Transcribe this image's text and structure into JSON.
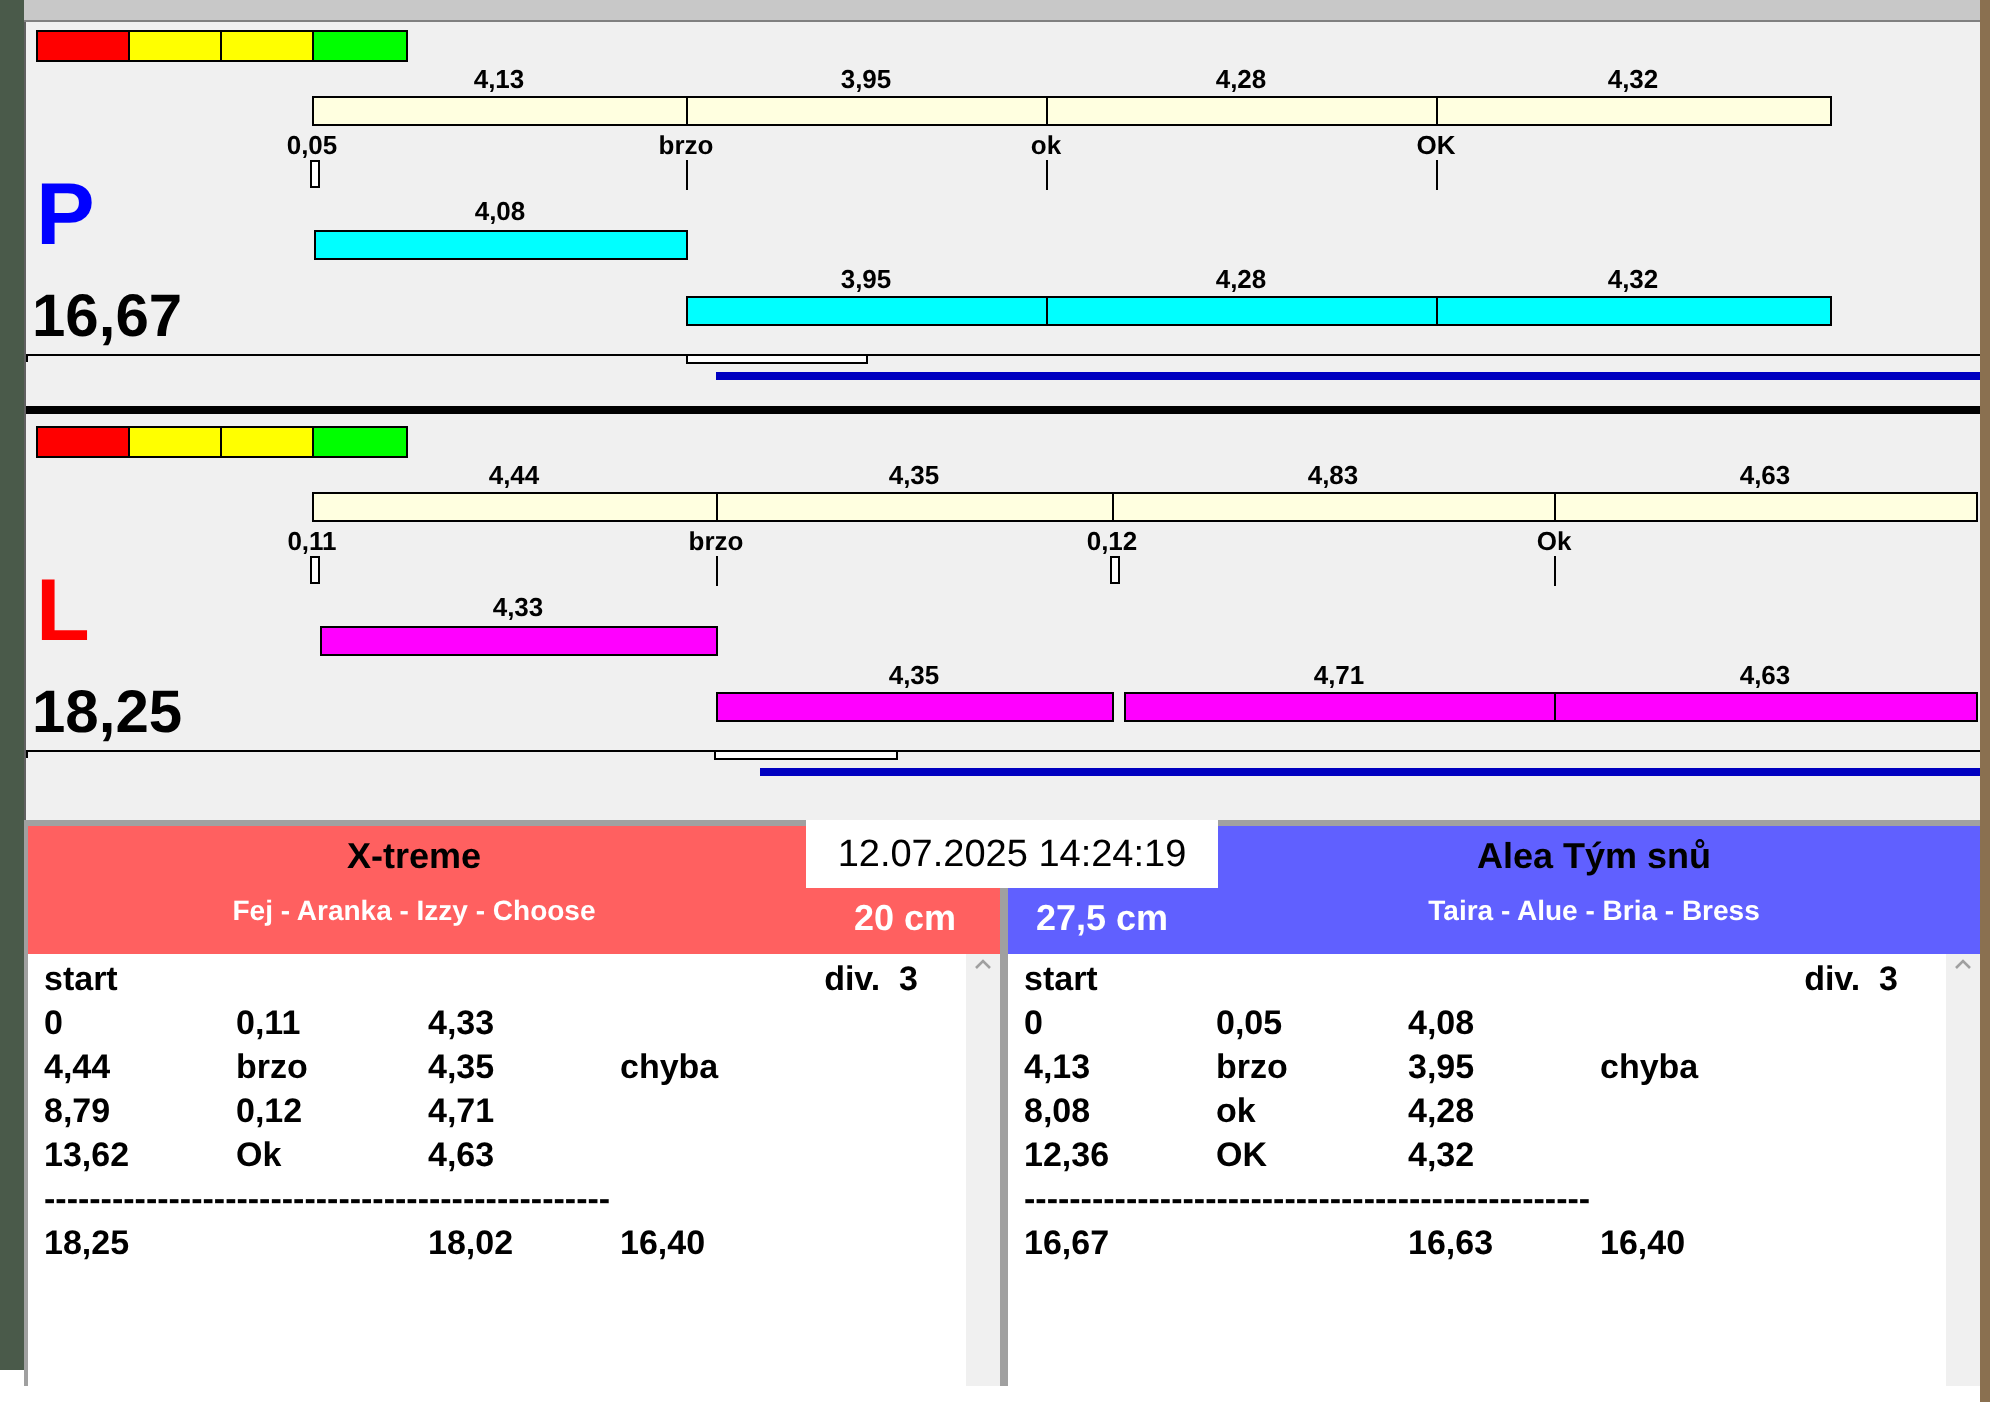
{
  "lanes": [
    {
      "letter": "P",
      "color": "#0000ff",
      "score": "16,67",
      "indicator": [
        {
          "color": "#ff0000"
        },
        {
          "color": "#ffff00"
        },
        {
          "color": "#ffff00"
        },
        {
          "color": "#00ff00"
        }
      ],
      "reference": [
        {
          "time": "4,13",
          "mark": "0,05",
          "kind": "box"
        },
        {
          "time": "3,95",
          "mark": "brzo",
          "kind": "line"
        },
        {
          "time": "4,28",
          "mark": "ok",
          "kind": "line"
        },
        {
          "time": "4,32",
          "mark": "OK",
          "kind": "line"
        }
      ],
      "runs": [
        "4,08",
        "3,95",
        "4,28",
        "4,32"
      ]
    },
    {
      "letter": "L",
      "color": "#ff0000",
      "score": "18,25",
      "indicator": [
        {
          "color": "#ff0000"
        },
        {
          "color": "#ffff00"
        },
        {
          "color": "#ffff00"
        },
        {
          "color": "#00ff00"
        }
      ],
      "reference": [
        {
          "time": "4,44",
          "mark": "0,11",
          "kind": "box"
        },
        {
          "time": "4,35",
          "mark": "brzo",
          "kind": "line"
        },
        {
          "time": "4,83",
          "mark": "0,12",
          "kind": "box"
        },
        {
          "time": "4,63",
          "mark": "Ok",
          "kind": "line"
        }
      ],
      "runs": [
        "4,33",
        "4,35",
        "4,71",
        "4,63"
      ]
    }
  ],
  "timestamp": "12.07.2025 14:24:19",
  "teams": [
    {
      "name": "X-treme",
      "members": "Fej - Aranka - Izzy - Choose",
      "height": "20 cm",
      "color": "#ff6060",
      "start": "start",
      "division": "div.  3",
      "rows": [
        [
          "0",
          "0,11",
          "4,33"
        ],
        [
          "4,44",
          "brzo",
          "4,35",
          "chyba"
        ],
        [
          "8,79",
          "0,12",
          "4,71"
        ],
        [
          "13,62",
          "Ok",
          "4,63"
        ]
      ],
      "separator": "--------------------------------------------------",
      "total": {
        "column_1": "18,25",
        "column_3": "18,02",
        "column_4": "16,40"
      }
    },
    {
      "name": "Alea Tým snů",
      "members": "Taira - Alue - Bria - Bress",
      "height": "27,5 cm",
      "color": "#6060ff",
      "start": "start",
      "division": "div.  3",
      "rows": [
        [
          "0",
          "0,05",
          "4,08"
        ],
        [
          "4,13",
          "brzo",
          "3,95",
          "chyba"
        ],
        [
          "8,08",
          "ok",
          "4,28"
        ],
        [
          "12,36",
          "OK",
          "4,32"
        ]
      ],
      "separator": "--------------------------------------------------",
      "total": {
        "column_1": "16,67",
        "column_3": "16,63",
        "column_4": "16,40"
      }
    }
  ]
}
